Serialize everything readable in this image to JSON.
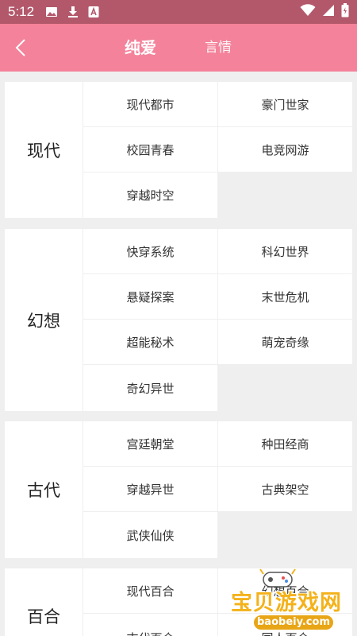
{
  "status_bar": {
    "time": "5:12",
    "icons": [
      "image-icon",
      "download-icon",
      "a-box-icon",
      "wifi-icon",
      "signal-icon",
      "battery-icon"
    ]
  },
  "header": {
    "back_icon": "chevron-left-icon",
    "tabs": [
      {
        "label": "纯爱",
        "active": true
      },
      {
        "label": "言情",
        "active": false
      }
    ],
    "bg_color": "#f4829a"
  },
  "sections": [
    {
      "label": "现代",
      "items": [
        "现代都市",
        "豪门世家",
        "校园青春",
        "电竞网游",
        "穿越时空"
      ]
    },
    {
      "label": "幻想",
      "items": [
        "快穿系统",
        "科幻世界",
        "悬疑探案",
        "末世危机",
        "超能秘术",
        "萌宠奇缘",
        "奇幻异世"
      ]
    },
    {
      "label": "古代",
      "items": [
        "宫廷朝堂",
        "种田经商",
        "穿越异世",
        "古典架空",
        "武侠仙侠"
      ]
    },
    {
      "label": "百合",
      "items": [
        "现代百合",
        "幻想百合",
        "古代百合",
        "同人百合"
      ]
    }
  ],
  "watermark": {
    "text": "宝贝游戏网",
    "url": "baobeiy.com"
  }
}
